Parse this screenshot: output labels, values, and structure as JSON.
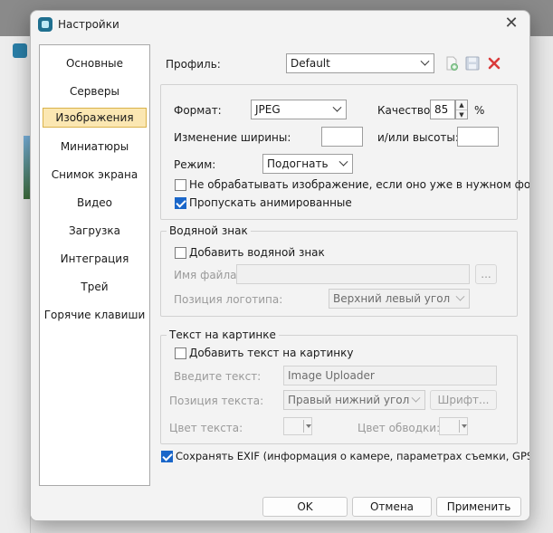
{
  "window": {
    "title": "Настройки"
  },
  "nav": {
    "items": [
      {
        "label": "Основные"
      },
      {
        "label": "Серверы"
      },
      {
        "label": "Изображения",
        "active": true
      },
      {
        "label": "Миниатюры"
      },
      {
        "label": "Снимок экрана"
      },
      {
        "label": "Видео"
      },
      {
        "label": "Загрузка"
      },
      {
        "label": "Интеграция"
      },
      {
        "label": "Трей"
      },
      {
        "label": "Горячие клавиши"
      }
    ]
  },
  "profile": {
    "label": "Профиль:",
    "value": "Default"
  },
  "image": {
    "format_label": "Формат:",
    "format_value": "JPEG",
    "quality_label": "Качество:",
    "quality_value": "85",
    "quality_unit": "%",
    "width_label": "Изменение ширины:",
    "width_value": "",
    "height_label": "и/или высоты:",
    "height_value": "",
    "mode_label": "Режим:",
    "mode_value": "Подогнать",
    "skip_processing_label": "Не обрабатывать изображение, если оно уже в нужном формате",
    "skip_processing_checked": false,
    "skip_animated_label": "Пропускать анимированные",
    "skip_animated_checked": true
  },
  "watermark": {
    "title": "Водяной знак",
    "add_label": "Добавить водяной знак",
    "add_checked": false,
    "file_label": "Имя файла:",
    "file_value": "",
    "browse_label": "...",
    "position_label": "Позиция логотипа:",
    "position_value": "Верхний левый угол"
  },
  "text_overlay": {
    "title": "Текст на картинке",
    "add_label": "Добавить текст на картинку",
    "add_checked": false,
    "text_label": "Введите текст:",
    "text_value": "Image Uploader",
    "position_label": "Позиция текста:",
    "position_value": "Правый нижний угол",
    "font_button": "Шрифт...",
    "text_color_label": "Цвет текста:",
    "stroke_color_label": "Цвет обводки:"
  },
  "exif": {
    "label": "Сохранять EXIF (информация о камере, параметрах съемки, GPS и т.п.)",
    "checked": true
  },
  "buttons": {
    "ok": "OK",
    "cancel": "Отмена",
    "apply": "Применить"
  },
  "colors": {
    "accent": "#1a66c9",
    "nav_active_bg": "#fbe7b2",
    "delete_red": "#d93a3a",
    "add_green": "#3aa64a"
  }
}
